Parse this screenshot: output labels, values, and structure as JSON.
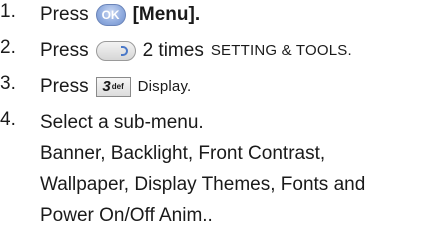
{
  "steps": [
    {
      "number": "1.",
      "press": "Press",
      "key": "OK",
      "action": "[Menu]."
    },
    {
      "number": "2.",
      "press": "Press",
      "key_icon": "nav-right-key-icon",
      "count": "2 times",
      "target": "SETTING & TOOLS."
    },
    {
      "number": "3.",
      "press": "Press",
      "key_digit": "3",
      "key_letters": "def",
      "target": "Display."
    },
    {
      "number": "4.",
      "lines": [
        "Select a sub-menu.",
        "Banner, Backlight, Front Contrast,",
        "Wallpaper, Display Themes, Fonts and",
        "Power On/Off Anim.."
      ]
    }
  ]
}
